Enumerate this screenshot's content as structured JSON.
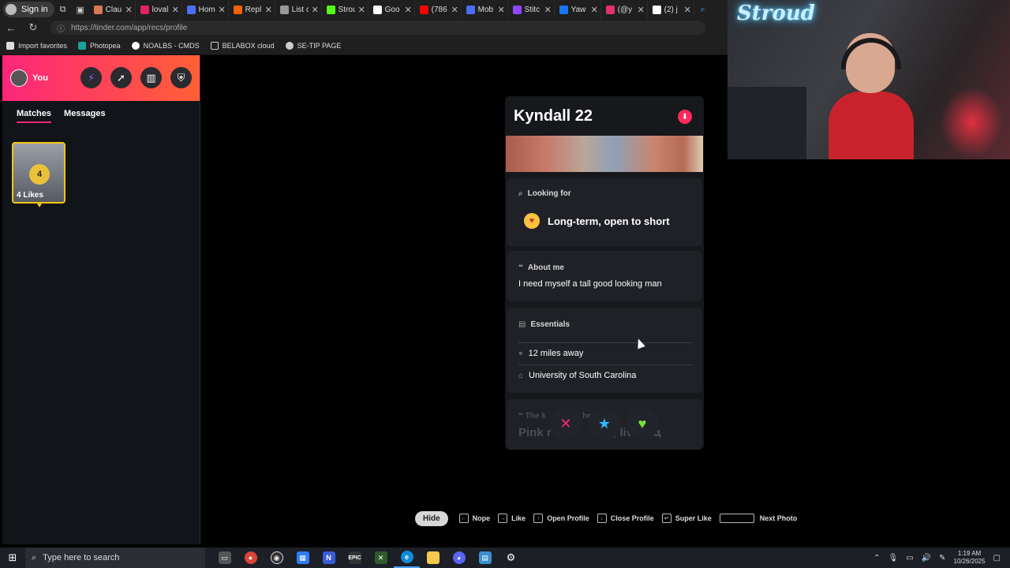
{
  "browser": {
    "signin_label": "Sign in",
    "tabs": [
      {
        "title": "Clau",
        "color": "#d97757"
      },
      {
        "title": "lovali",
        "color": "#e0245e"
      },
      {
        "title": "Hom",
        "color": "#4c6ef5"
      },
      {
        "title": "Repl",
        "color": "#f26207"
      },
      {
        "title": "List c",
        "color": "#999999"
      },
      {
        "title": "Strou",
        "color": "#53fc18"
      },
      {
        "title": "Goo",
        "color": "#ffffff"
      },
      {
        "title": "(786",
        "color": "#ff0000"
      },
      {
        "title": "Mob",
        "color": "#4c6ef5"
      },
      {
        "title": "Stitc",
        "color": "#9146ff"
      },
      {
        "title": "Yaw",
        "color": "#1877f2"
      },
      {
        "title": "(@y",
        "color": "#e1306c"
      },
      {
        "title": "(2) j",
        "color": "#ffffff"
      }
    ],
    "url": "https://tinder.com/app/recs/profile",
    "favorites": [
      "Import favorites",
      "Photopea",
      "NOALBS - CMDS",
      "BELABOX cloud",
      "SE-TIP PAGE"
    ]
  },
  "sidebar": {
    "user_label": "You",
    "header_icons": [
      "lightning-icon",
      "compass-icon",
      "briefcase-icon",
      "shield-icon"
    ],
    "tabs": [
      {
        "label": "Matches"
      },
      {
        "label": "Messages"
      }
    ],
    "likes": {
      "count": "4",
      "label": "4 Likes"
    }
  },
  "profile": {
    "name_age": "Kyndall 22",
    "looking_for": {
      "heading": "Looking for",
      "value": "Long-term, open to short"
    },
    "about": {
      "heading": "About me",
      "text": "I need myself a tall good looking man"
    },
    "essentials": {
      "heading": "Essentials",
      "distance": "12 miles away",
      "school": "University of South Carolina"
    },
    "next_section": {
      "heading": "The k",
      "heading_tail": "her",
      "text_a": "Pink r",
      "text_b": "ses, live mu",
      "text_c": "ic,"
    }
  },
  "actions": [
    "nope-icon",
    "super-like-icon",
    "like-icon"
  ],
  "hints": {
    "hide": "Hide",
    "items": [
      "Nope",
      "Like",
      "Open Profile",
      "Close Profile",
      "Super Like",
      "Next Photo"
    ]
  },
  "webcam": {
    "neon_text": "Stroud"
  },
  "taskbar": {
    "search_placeholder": "Type here to search",
    "time": "1:19 AM",
    "date": "10/26/2025"
  }
}
